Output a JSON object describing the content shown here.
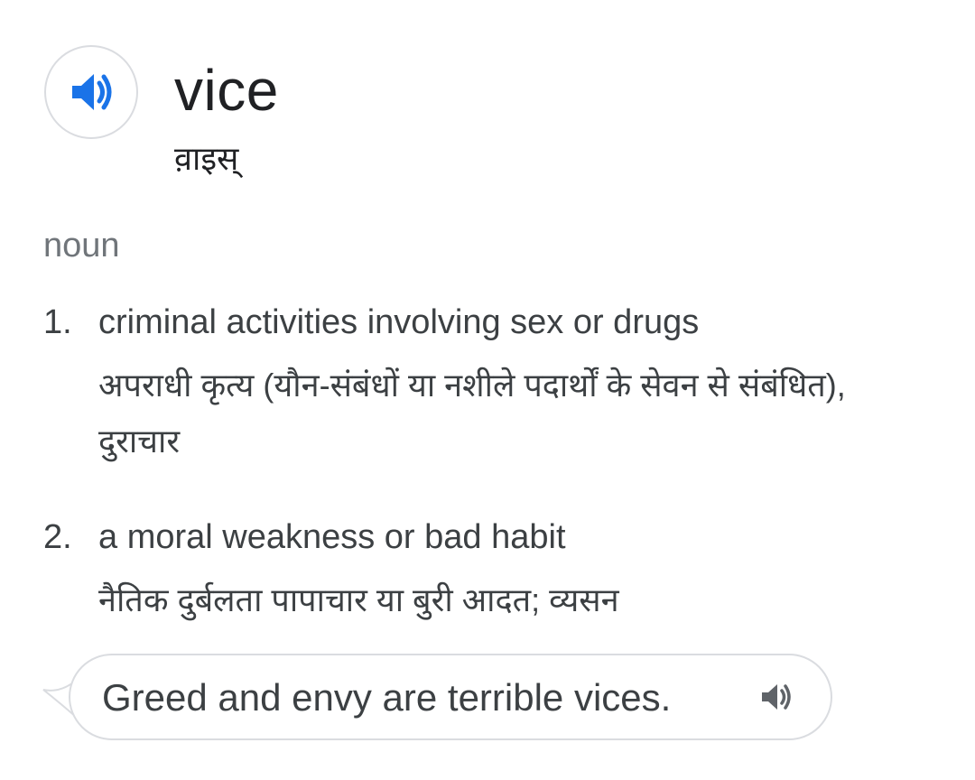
{
  "entry": {
    "word": "vice",
    "pronunciation": "व़ाइस्",
    "part_of_speech": "noun",
    "audio_icon": "speaker-icon",
    "accent_color": "#1a73e8"
  },
  "senses": [
    {
      "number": "1.",
      "gloss": "criminal activities involving sex or drugs",
      "translation": "अपराधी कृत्य (यौन-संबंधों या नशीले पदार्थों के सेवन से संबंधित), दुराचार"
    },
    {
      "number": "2.",
      "gloss": "a moral weakness or bad habit",
      "translation": "नैतिक दुर्बलता पापाचार या बुरी आदत; व्यसन"
    }
  ],
  "example": {
    "text": "Greed and envy are terrible vices.",
    "audio_icon": "speaker-icon"
  }
}
